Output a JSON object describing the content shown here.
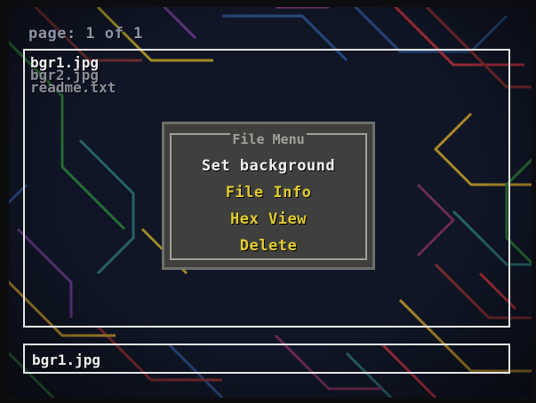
{
  "header": {
    "page_indicator": "page: 1 of 1"
  },
  "file_list": {
    "items": [
      {
        "name": "bgr1.jpg",
        "selected": true
      },
      {
        "name": "bgr2.jpg",
        "selected": false
      },
      {
        "name": "readme.txt",
        "selected": false
      }
    ]
  },
  "file_menu": {
    "title": "File Menu",
    "items": [
      {
        "label": "Set background",
        "highlighted": true
      },
      {
        "label": "File Info",
        "highlighted": false
      },
      {
        "label": "Hex View",
        "highlighted": false
      },
      {
        "label": "Delete",
        "highlighted": false
      }
    ]
  },
  "status_bar": {
    "selected_file": "bgr1.jpg"
  },
  "colors": {
    "background": "#101626",
    "frame": "#e6e6e6",
    "menu_bg": "#3f3f3d",
    "menu_item": "#e2cc31",
    "menu_item_active": "#f0f0f0",
    "dim_text": "#8b8e99"
  }
}
